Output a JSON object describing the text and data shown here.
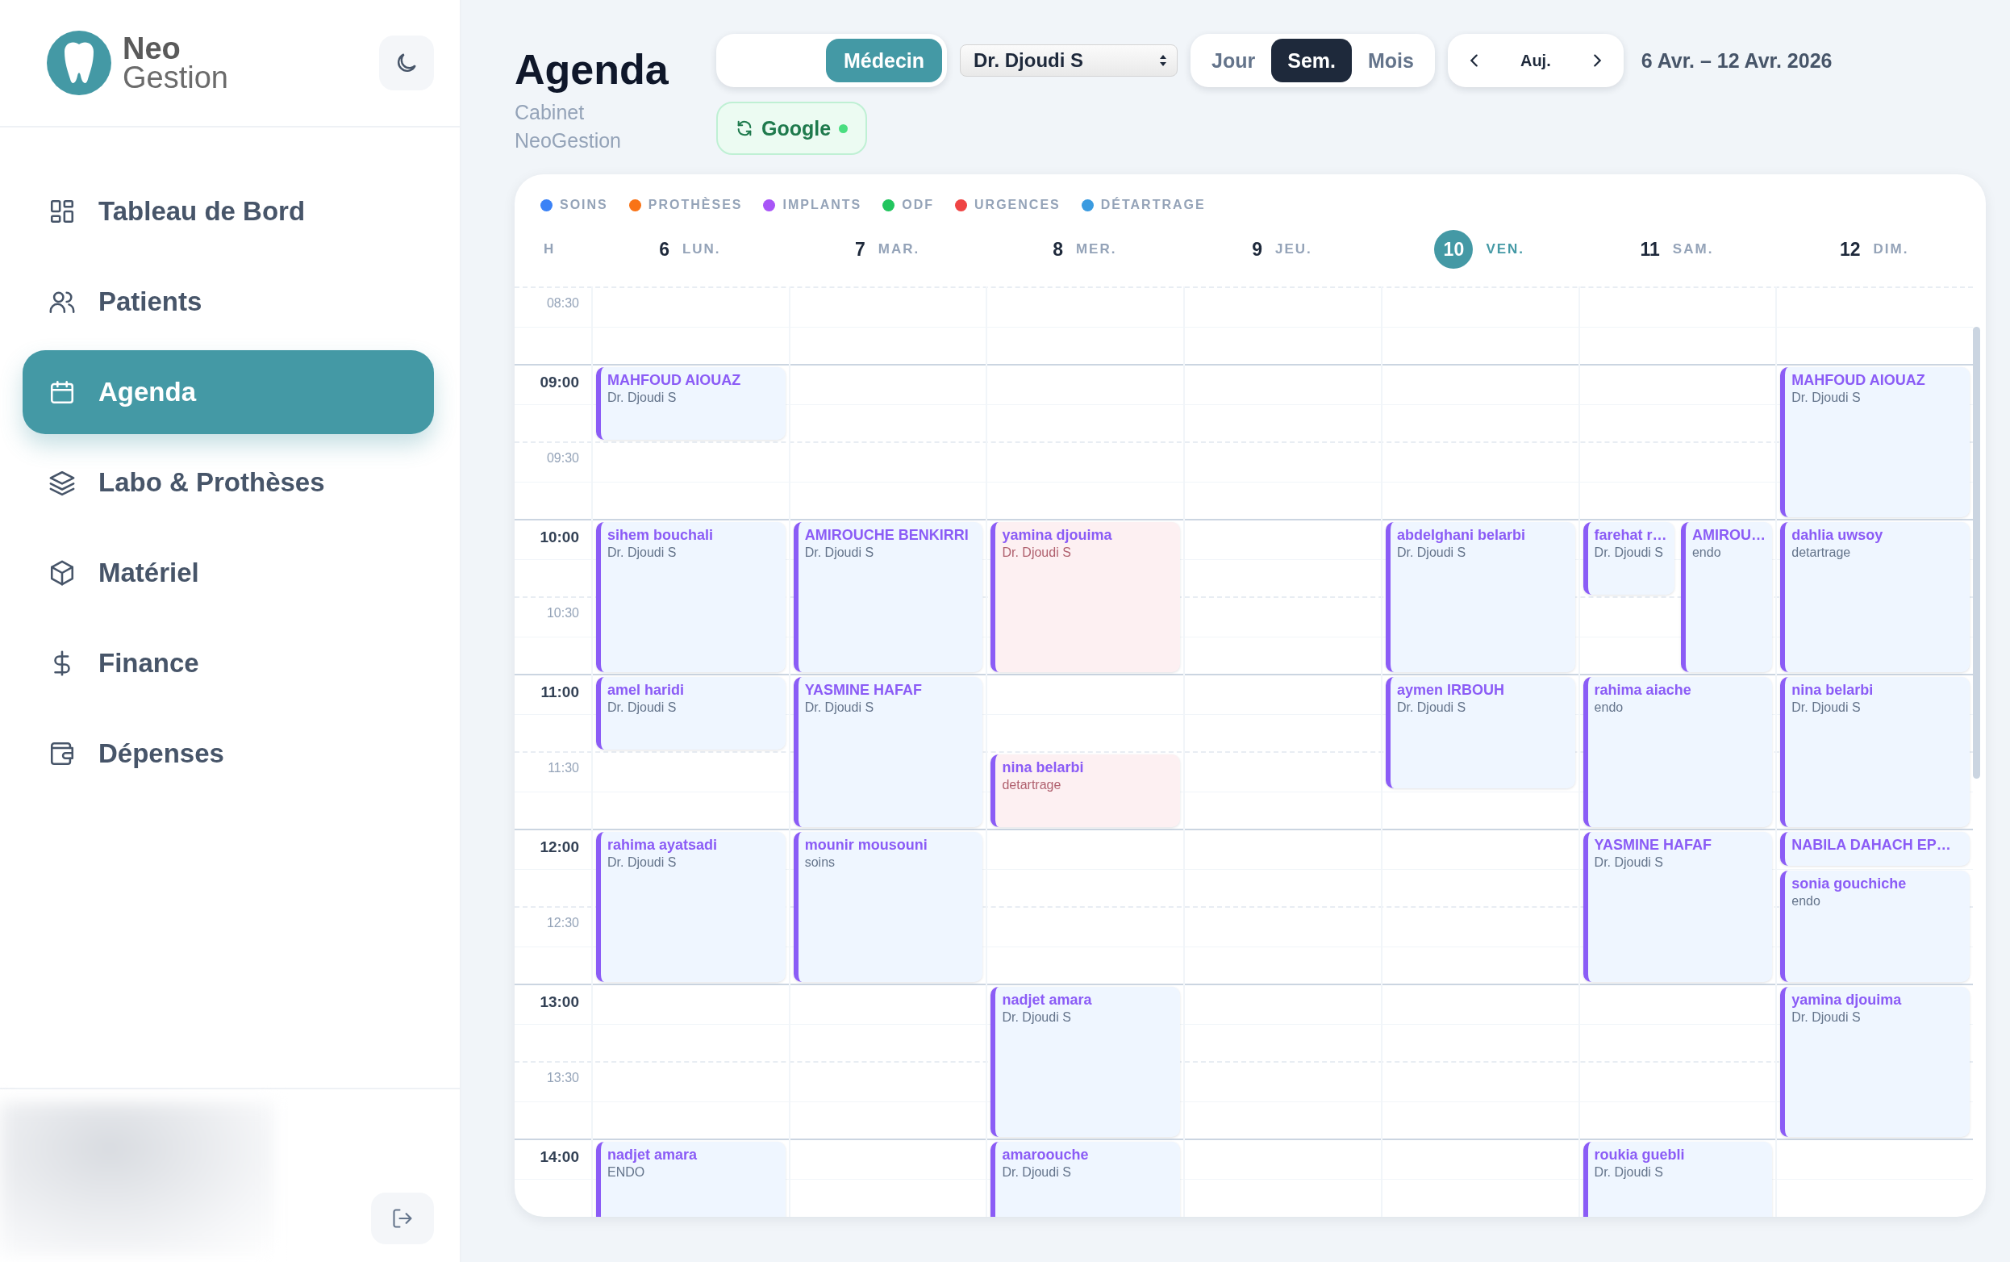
{
  "brand": {
    "name_top": "Neo",
    "name_bottom": "Gestion"
  },
  "sidebar": {
    "items": [
      {
        "label": "Tableau de Bord",
        "selected": false
      },
      {
        "label": "Patients",
        "selected": false
      },
      {
        "label": "Agenda",
        "selected": true
      },
      {
        "label": "Labo & Prothèses",
        "selected": false
      },
      {
        "label": "Matériel",
        "selected": false
      },
      {
        "label": "Finance",
        "selected": false
      },
      {
        "label": "Dépenses",
        "selected": false
      }
    ]
  },
  "header": {
    "title": "Agenda",
    "subtitle": "Cabinet NeoGestion",
    "mode_toggle": [
      {
        "label": "Médecin",
        "selected": true
      }
    ],
    "doctor_select": {
      "value": "Dr. Djoudi S"
    },
    "view_tabs": [
      {
        "label": "Jour",
        "selected": false
      },
      {
        "label": "Sem.",
        "selected": true
      },
      {
        "label": "Mois",
        "selected": false
      }
    ],
    "today_button": "Auj.",
    "date_range": "6 Avr. – 12 Avr. 2026",
    "google_button": {
      "label": "Google",
      "connected": true
    }
  },
  "legend": [
    {
      "label": "SOINS",
      "color": "#3b82f6"
    },
    {
      "label": "PROTHÈSES",
      "color": "#f97316"
    },
    {
      "label": "IMPLANTS",
      "color": "#a855f7"
    },
    {
      "label": "ODF",
      "color": "#22c55e"
    },
    {
      "label": "URGENCES",
      "color": "#ef4444"
    },
    {
      "label": "DÉTARTRAGE",
      "color": "#3b9be0"
    }
  ],
  "calendar": {
    "hour_column": "H",
    "time_slots": [
      {
        "label": "08:30",
        "kind": "half"
      },
      {
        "label": "09:00",
        "kind": "hour"
      },
      {
        "label": "09:30",
        "kind": "half"
      },
      {
        "label": "10:00",
        "kind": "hour"
      },
      {
        "label": "10:30",
        "kind": "half"
      },
      {
        "label": "11:00",
        "kind": "hour"
      },
      {
        "label": "11:30",
        "kind": "half"
      },
      {
        "label": "12:00",
        "kind": "hour"
      },
      {
        "label": "12:30",
        "kind": "half"
      },
      {
        "label": "13:00",
        "kind": "hour"
      },
      {
        "label": "13:30",
        "kind": "half"
      },
      {
        "label": "14:00",
        "kind": "hour"
      }
    ],
    "days": [
      {
        "number": "6",
        "label": "LUN.",
        "selected": false,
        "events": [
          {
            "title": "MAHFOUD AIOUAZ",
            "detail": "Dr. Djoudi S",
            "kind": "standard"
          },
          {
            "title": "sihem bouchali",
            "detail": "Dr. Djoudi S",
            "kind": "standard"
          },
          {
            "title": "amel haridi",
            "detail": "Dr. Djoudi S",
            "kind": "standard"
          },
          {
            "title": "rahima ayatsadi",
            "detail": "Dr. Djoudi S",
            "kind": "standard"
          },
          {
            "title": "nadjet amara",
            "detail": "ENDO",
            "kind": "standard"
          }
        ]
      },
      {
        "number": "7",
        "label": "MAR.",
        "selected": false,
        "events": [
          {
            "title": "AMIROUCHE BENKIRRI",
            "detail": "Dr. Djoudi S",
            "kind": "standard"
          },
          {
            "title": "YASMINE HAFAF",
            "detail": "Dr. Djoudi S",
            "kind": "standard"
          },
          {
            "title": "mounir mousouni",
            "detail": "soins",
            "kind": "standard"
          }
        ]
      },
      {
        "number": "8",
        "label": "MER.",
        "selected": false,
        "events": [
          {
            "title": "yamina djouima",
            "detail": "Dr. Djoudi S",
            "kind": "urgent"
          },
          {
            "title": "nina belarbi",
            "detail": "detartrage",
            "kind": "urgent"
          },
          {
            "title": "nadjet amara",
            "detail": "Dr. Djoudi S",
            "kind": "standard"
          },
          {
            "title": "amaroouche",
            "detail": "Dr. Djoudi S",
            "kind": "standard"
          }
        ]
      },
      {
        "number": "9",
        "label": "JEU.",
        "selected": false
      },
      {
        "number": "10",
        "label": "VEN.",
        "selected": true,
        "events": [
          {
            "title": "abdelghani belarbi",
            "detail": "Dr. Djoudi S",
            "kind": "standard"
          },
          {
            "title": "aymen IRBOUH",
            "detail": "Dr. Djoudi S",
            "kind": "standard"
          }
        ]
      },
      {
        "number": "11",
        "label": "SAM.",
        "selected": false,
        "events": [
          {
            "title": "farehat r…",
            "detail": "Dr. Djoudi S",
            "kind": "standard"
          },
          {
            "title": "AMIROU…",
            "detail": "endo",
            "kind": "standard"
          },
          {
            "title": "rahima aiache",
            "detail": "endo",
            "kind": "standard"
          },
          {
            "title": "YASMINE HAFAF",
            "detail": "Dr. Djoudi S",
            "kind": "standard"
          },
          {
            "title": "roukia guebli",
            "detail": "Dr. Djoudi S",
            "kind": "standard"
          }
        ]
      },
      {
        "number": "12",
        "label": "DIM.",
        "selected": false,
        "events": [
          {
            "title": "MAHFOUD AIOUAZ",
            "detail": "Dr. Djoudi S",
            "kind": "standard"
          },
          {
            "title": "dahlia uwsoy",
            "detail": "detartrage",
            "kind": "standard"
          },
          {
            "title": "nina belarbi",
            "detail": "Dr. Djoudi S",
            "kind": "standard"
          },
          {
            "title": "NABILA DAHACH EP…",
            "kind": "standard"
          },
          {
            "title": "sonia gouchiche",
            "detail": "endo",
            "kind": "standard"
          },
          {
            "title": "yamina djouima",
            "detail": "Dr. Djoudi S",
            "kind": "standard"
          }
        ]
      }
    ]
  }
}
